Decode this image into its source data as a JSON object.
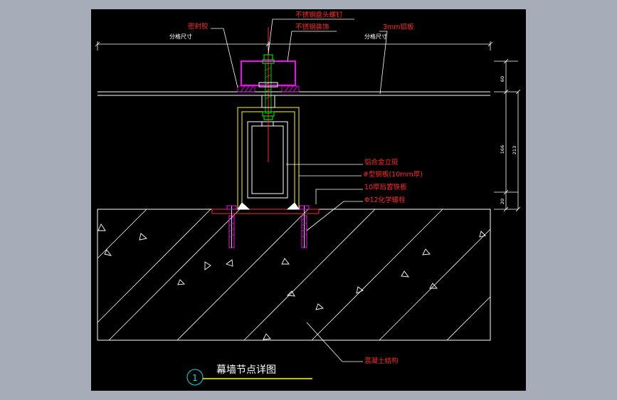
{
  "drawing": {
    "title": "幕墙节点详图",
    "detail_number": "1",
    "labels": {
      "bolt": "不锈钢盘头螺钉",
      "trim": "不锈钢装饰",
      "sealant": "密封胶",
      "plate": "3mm铝板",
      "mullion": "铝合金立挺",
      "channel": "#型钢板(10mm厚)",
      "embed_plate": "10厚后置铁板",
      "anchor": "Φ12化学螺栓",
      "concrete": "混凝土结构"
    },
    "grid_left": "分格尺寸",
    "grid_right": "分格尺寸",
    "dimensions": {
      "d1": "60",
      "d2": "166",
      "d3": "213",
      "d4": "20"
    }
  },
  "colors": {
    "red": "#ff2a2a",
    "magenta": "#ff00ff",
    "yellow": "#ffff00",
    "green": "#00ff00",
    "cyan": "#00e0e0",
    "white": "#ffffff"
  }
}
